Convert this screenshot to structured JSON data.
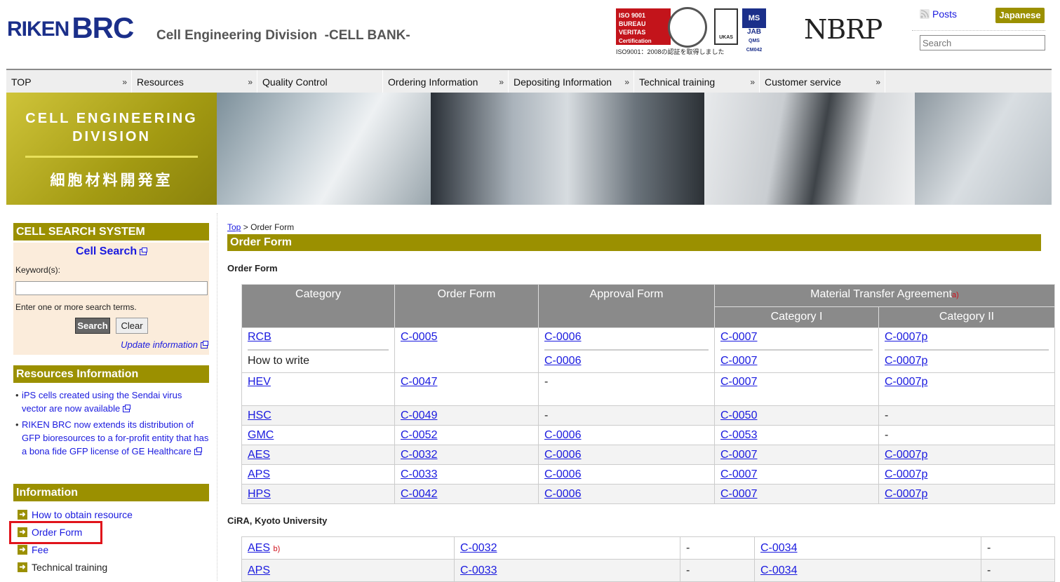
{
  "header": {
    "logo_riken": "RIKEN",
    "logo_brc": "BRC",
    "division": "Cell Engineering Division  -CELL BANK-",
    "iso_red": "ISO 9001\nBUREAU VERITAS\nCertification",
    "iso_caption": "ISO9001：2008の認証を取得しました",
    "nbrp": "NBRP",
    "posts_label": "Posts",
    "language_button": "Japanese",
    "search_placeholder": "Search"
  },
  "nav": {
    "items": [
      {
        "label": "TOP"
      },
      {
        "label": "Resources"
      },
      {
        "label": "Quality Control"
      },
      {
        "label": "Ordering Information"
      },
      {
        "label": "Depositing Information"
      },
      {
        "label": "Technical training"
      },
      {
        "label": "Customer service"
      }
    ]
  },
  "banner": {
    "title_en_1": "CELL ENGINEERING",
    "title_en_2": "DIVISION",
    "title_ja": "細胞材料開発室"
  },
  "sidebar": {
    "cell_search_heading": "CELL SEARCH SYSTEM",
    "cell_search_link": "Cell Search",
    "keyword_label": "Keyword(s):",
    "hint": "Enter one or more search terms.",
    "search_button": "Search",
    "clear_button": "Clear",
    "update_link": "Update information",
    "resources_heading": "Resources Information",
    "resources": [
      "iPS cells created using the Sendai virus vector are now available",
      "RIKEN BRC now extends its distribution of GFP bioresources to a for-profit entity that has a bona fide GFP license of GE Healthcare"
    ],
    "information_heading": "Information",
    "information_items": [
      "How to obtain resource",
      "Order Form",
      "Fee",
      "Technical training"
    ]
  },
  "main": {
    "breadcrumb_top": "Top",
    "breadcrumb_sep": ">",
    "breadcrumb_current": "Order Form",
    "page_title": "Order Form",
    "section1": "Order Form",
    "section2": "CiRA, Kyoto University",
    "table1": {
      "headers": {
        "category": "Category",
        "order_form": "Order Form",
        "approval_form": "Approval Form",
        "mta": "Material Transfer Agreement",
        "mta_note": "a)",
        "cat1": "Category I",
        "cat2": "Category II"
      },
      "how_to_write": "How to write",
      "rows": [
        {
          "category": "RCB",
          "order": "C-0005",
          "approval": "C-0006",
          "cat1": "C-0007",
          "cat2": "C-0007p"
        },
        {
          "category": "HEV",
          "order": "C-0047",
          "approval": "-",
          "cat1": "C-0007",
          "cat2": "C-0007p"
        },
        {
          "category": "HSC",
          "order": "C-0049",
          "approval": "-",
          "cat1": "C-0050",
          "cat2": "-"
        },
        {
          "category": "GMC",
          "order": "C-0052",
          "approval": "C-0006",
          "cat1": "C-0053",
          "cat2": "-"
        },
        {
          "category": "AES",
          "order": "C-0032",
          "approval": "C-0006",
          "cat1": "C-0007",
          "cat2": "C-0007p"
        },
        {
          "category": "APS",
          "order": "C-0033",
          "approval": "C-0006",
          "cat1": "C-0007",
          "cat2": "C-0007p"
        },
        {
          "category": "HPS",
          "order": "C-0042",
          "approval": "C-0006",
          "cat1": "C-0007",
          "cat2": "C-0007p"
        }
      ],
      "rcb_howto": {
        "approval": "C-0006",
        "cat1": "C-0007",
        "cat2": "C-0007p"
      }
    },
    "table2": {
      "rows": [
        {
          "category": "AES",
          "note": "b)",
          "order": "C-0032",
          "approval": "-",
          "mta": "C-0034",
          "other": "-"
        },
        {
          "category": "APS",
          "note": "",
          "order": "C-0033",
          "approval": "-",
          "mta": "C-0034",
          "other": "-"
        }
      ]
    }
  },
  "colors": {
    "accent": "#9b9000",
    "link": "#1a1adf",
    "highlight": "#e0141b",
    "table_header": "#8a8a8a"
  }
}
